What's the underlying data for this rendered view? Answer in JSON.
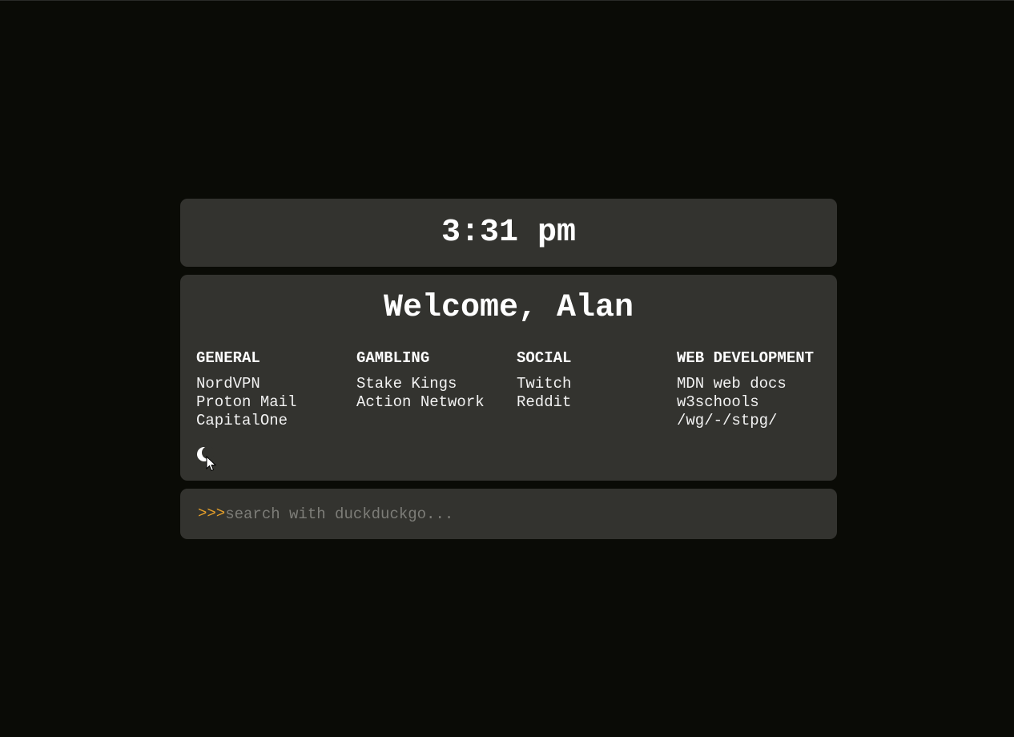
{
  "clock": {
    "time": "3:31 pm"
  },
  "welcome": {
    "text": "Welcome, Alan"
  },
  "categories": [
    {
      "title": "GENERAL",
      "links": [
        "NordVPN",
        "Proton Mail",
        "CapitalOne"
      ]
    },
    {
      "title": "GAMBLING",
      "links": [
        "Stake Kings",
        "Action Network"
      ]
    },
    {
      "title": "SOCIAL",
      "links": [
        "Twitch",
        "Reddit"
      ]
    },
    {
      "title": "WEB DEVELOPMENT",
      "links": [
        "MDN web docs",
        "w3schools",
        "/wg/-/stpg/"
      ]
    }
  ],
  "theme_toggle": {
    "icon": "moon-icon"
  },
  "search": {
    "prompt": ">>>",
    "placeholder": "search with duckduckgo...",
    "value": ""
  },
  "colors": {
    "background": "#0a0b06",
    "panel": "#33332f",
    "accent": "#e6a02a",
    "text": "#ffffff",
    "placeholder": "#7d7d78"
  }
}
